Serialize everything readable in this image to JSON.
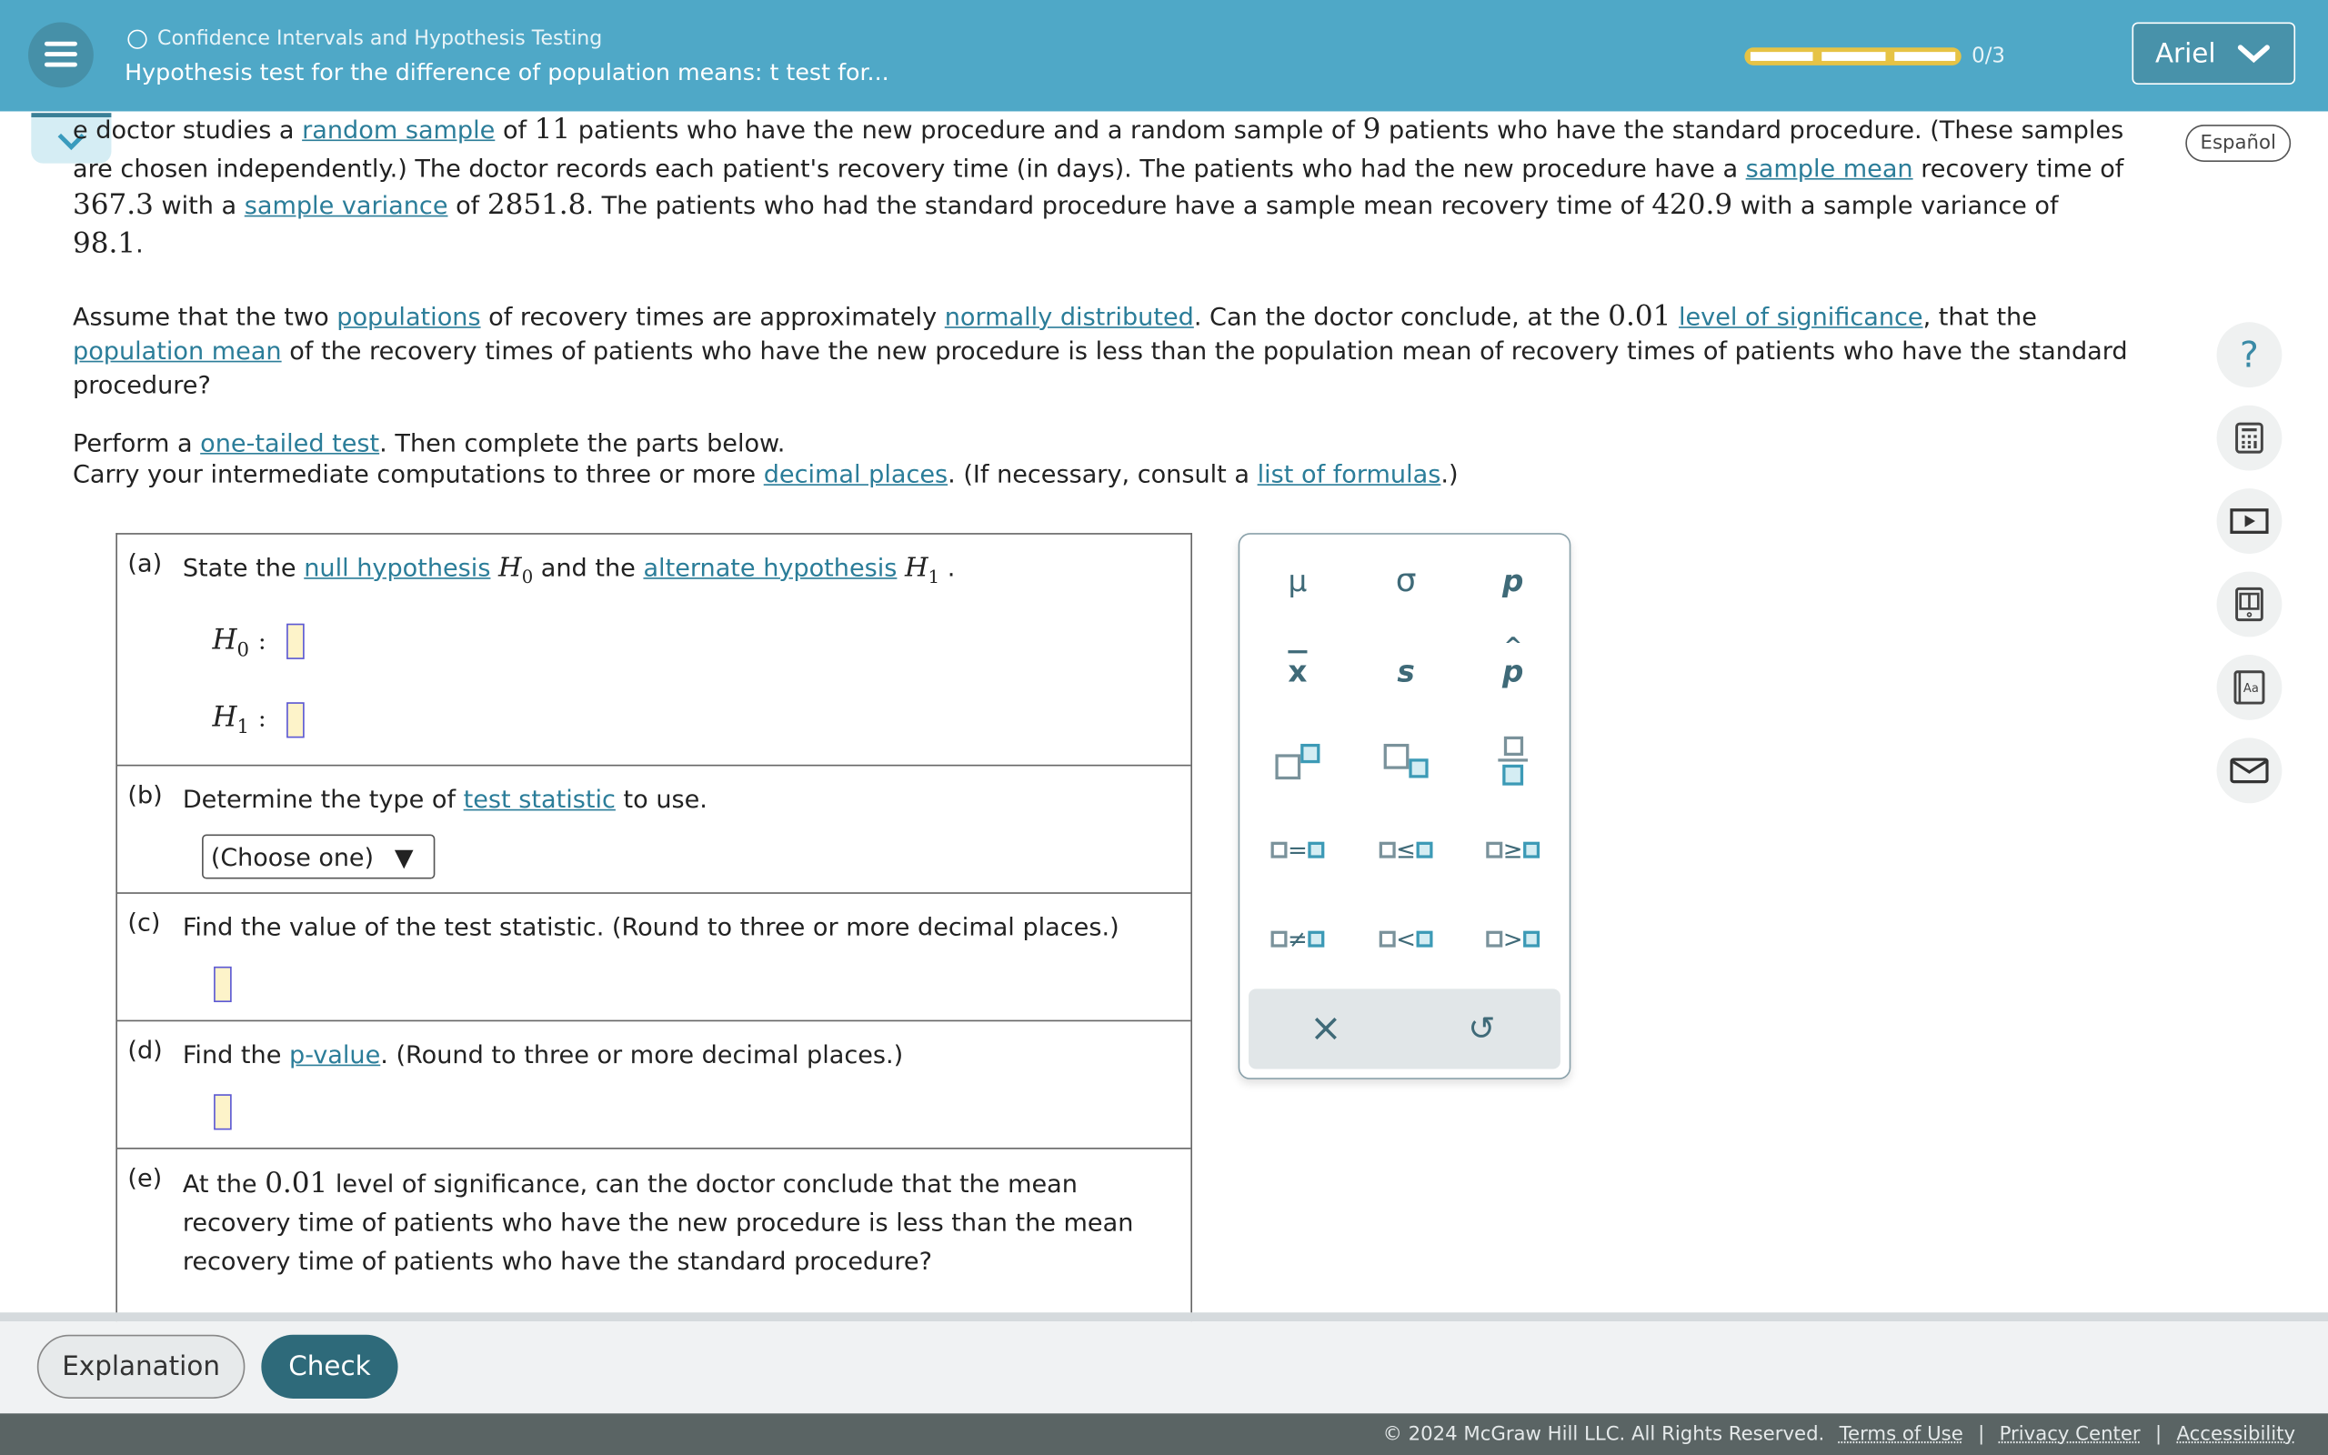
{
  "header": {
    "breadcrumb": "Confidence Intervals and Hypothesis Testing",
    "title": "Hypothesis test for the difference of population means: t test for...",
    "progress": {
      "completed": 0,
      "total": 3,
      "label": "0/3"
    },
    "user": "Ariel",
    "colors": {
      "header": "#4fa8c7",
      "progress": "#e6c345",
      "link": "#2b7d99",
      "check": "#2e6a7a"
    }
  },
  "espanol": "Español",
  "problem": {
    "p1": [
      {
        "t": "e doctor studies a "
      },
      {
        "t": "random sample",
        "link": true
      },
      {
        "t": " of "
      },
      {
        "t": "11",
        "num": true
      },
      {
        "t": " patients who have the new procedure and a random sample of "
      },
      {
        "t": "9",
        "num": true
      },
      {
        "t": " patients who have the standard procedure. (These samples are chosen independently.) The doctor records each patient's recovery time (in days). The patients who had the new procedure have a "
      },
      {
        "t": "sample mean",
        "link": true
      },
      {
        "t": " recovery time of "
      },
      {
        "t": "367.3",
        "num": true
      },
      {
        "t": " with a "
      },
      {
        "t": "sample variance",
        "link": true
      },
      {
        "t": " of "
      },
      {
        "t": "2851.8",
        "num": true
      },
      {
        "t": ". The patients who had the standard procedure have a sample mean recovery time of "
      },
      {
        "t": "420.9",
        "num": true
      },
      {
        "t": " with a sample variance of "
      },
      {
        "t": "98.1",
        "num": true
      },
      {
        "t": "."
      }
    ],
    "p2": [
      {
        "t": "Assume that the two "
      },
      {
        "t": "populations",
        "link": true
      },
      {
        "t": " of recovery times are approximately "
      },
      {
        "t": "normally distributed",
        "link": true
      },
      {
        "t": ". Can the doctor conclude, at the "
      },
      {
        "t": "0.01",
        "num": true
      },
      {
        "t": " "
      },
      {
        "t": "level of significance",
        "link": true
      },
      {
        "t": ", that the "
      },
      {
        "t": "population mean",
        "link": true
      },
      {
        "t": " of the recovery times of patients who have the new procedure is less than the population mean of recovery times of patients who have the standard procedure?"
      }
    ],
    "p3a": [
      {
        "t": "Perform a "
      },
      {
        "t": "one-tailed test",
        "link": true
      },
      {
        "t": ". Then complete the parts below."
      }
    ],
    "p3b": [
      {
        "t": "Carry your intermediate computations to three or more "
      },
      {
        "t": "decimal places",
        "link": true
      },
      {
        "t": ". (If necessary, consult a "
      },
      {
        "t": "list of formulas",
        "link": true
      },
      {
        "t": ".)"
      }
    ]
  },
  "parts": {
    "a": {
      "label": "(a)",
      "pre": "State the ",
      "l1": "null hypothesis",
      "mid": " and the ",
      "l2": "alternate hypothesis",
      "h0": "H",
      "h0sub": "0",
      "h1": "H",
      "h1sub": "1",
      "colon": ":",
      "end": " ."
    },
    "b": {
      "label": "(b)",
      "pre": "Determine the type of ",
      "link": "test statistic",
      "post": " to use.",
      "select": "(Choose one)",
      "arrow": "▼"
    },
    "c": {
      "label": "(c)",
      "text": "Find the value of the test statistic. (Round to three or more decimal places.)"
    },
    "d": {
      "label": "(d)",
      "pre": "Find the ",
      "link": "p-value",
      "post": ". (Round to three or more decimal places.)"
    },
    "e": {
      "label": "(e)",
      "pre": "At the ",
      "num": "0.01",
      "line1": " level of significance, can the doctor conclude that the mean",
      "line2": "recovery time of patients who have the new procedure is less than the mean",
      "line3": "recovery time of patients who have the standard procedure?"
    }
  },
  "keypad": {
    "mu": "μ",
    "sigma": "σ",
    "p": "p",
    "xbar": "x",
    "s": "s",
    "phat": "p",
    "eq": "=",
    "le": "≤",
    "ge": "≥",
    "ne": "≠",
    "lt": "<",
    "gt": ">",
    "clear": "×",
    "undo": "↺"
  },
  "footer": {
    "explanation": "Explanation",
    "check": "Check",
    "copyright": "© 2024 McGraw Hill LLC. All Rights Reserved.",
    "terms": "Terms of Use",
    "privacy": "Privacy Center",
    "accessibility": "Accessibility",
    "sep": "|"
  }
}
